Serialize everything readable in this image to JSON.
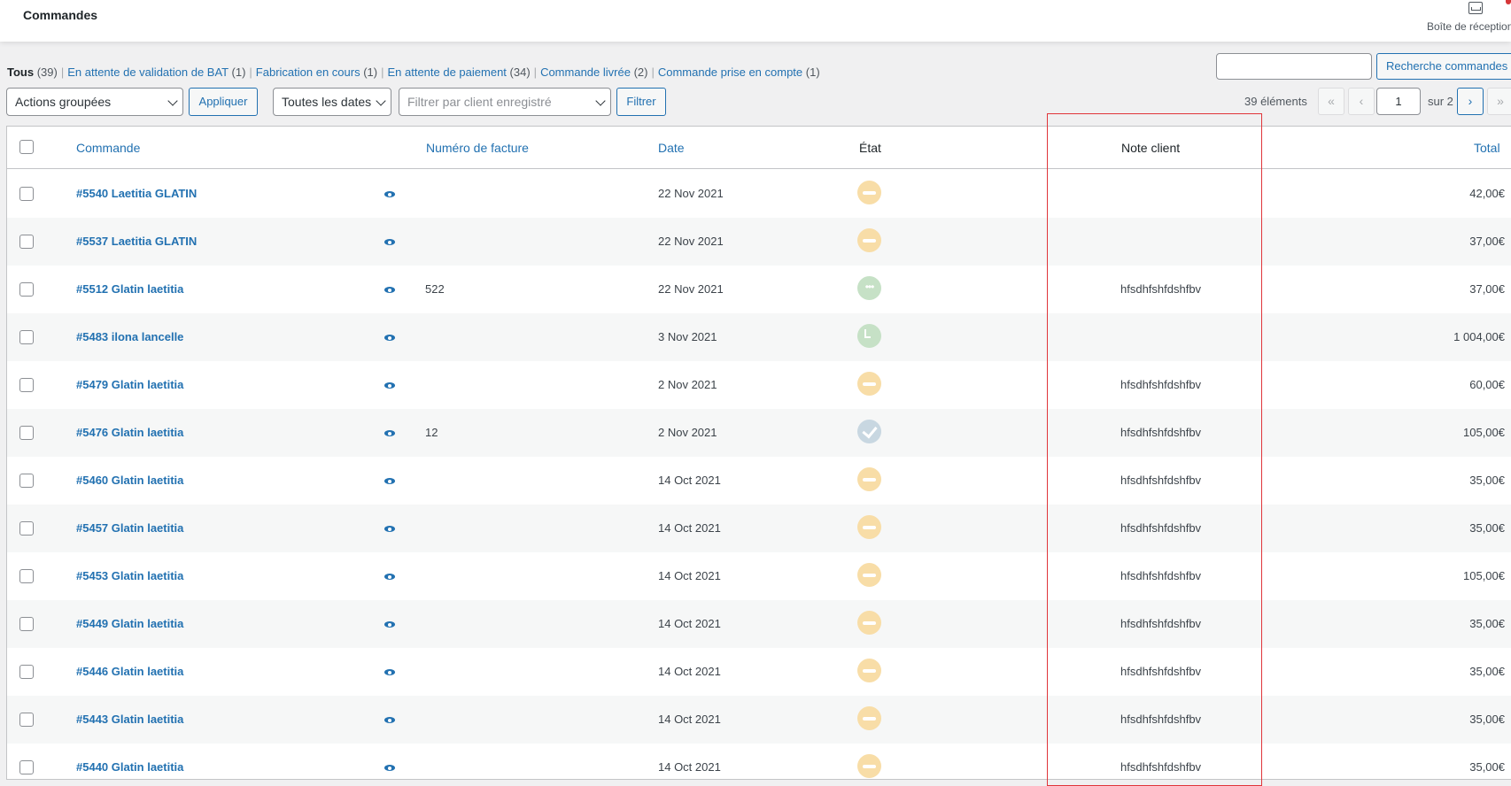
{
  "header": {
    "title": "Commandes",
    "inbox_label": "Boîte de réception"
  },
  "filters": {
    "all": {
      "label": "Tous",
      "count": "(39)"
    },
    "items": [
      {
        "label": "En attente de validation de BAT",
        "count": "(1)"
      },
      {
        "label": "Fabrication en cours",
        "count": "(1)"
      },
      {
        "label": "En attente de paiement",
        "count": "(34)"
      },
      {
        "label": "Commande livrée",
        "count": "(2)"
      },
      {
        "label": "Commande prise en compte",
        "count": "(1)"
      }
    ]
  },
  "search": {
    "value": "",
    "button": "Recherche commandes"
  },
  "toolbar": {
    "bulk_actions": "Actions groupées",
    "apply": "Appliquer",
    "dates": "Toutes les dates",
    "client_placeholder": "Filtrer par client enregistré",
    "filter": "Filtrer"
  },
  "pagination": {
    "count": "39 éléments",
    "first": "«",
    "prev": "‹",
    "next": "›",
    "last": "»",
    "current": "1",
    "of": "sur 2"
  },
  "columns": {
    "order": "Commande",
    "invoice": "Numéro de facture",
    "date": "Date",
    "status": "État",
    "note": "Note client",
    "total": "Total"
  },
  "rows": [
    {
      "order": "#5540 Laetitia GLATIN",
      "invoice": "",
      "date": "22 Nov 2021",
      "status": "pending",
      "note": "",
      "total": "42,00€"
    },
    {
      "order": "#5537 Laetitia GLATIN",
      "invoice": "",
      "date": "22 Nov 2021",
      "status": "pending",
      "note": "",
      "total": "37,00€"
    },
    {
      "order": "#5512 Glatin laetitia",
      "invoice": "522",
      "date": "22 Nov 2021",
      "status": "processing",
      "note": "hfsdhfshfdshfbv",
      "total": "37,00€"
    },
    {
      "order": "#5483 ilona lancelle",
      "invoice": "",
      "date": "3 Nov 2021",
      "status": "onhold",
      "note": "",
      "total": "1 004,00€"
    },
    {
      "order": "#5479 Glatin laetitia",
      "invoice": "",
      "date": "2 Nov 2021",
      "status": "pending",
      "note": "hfsdhfshfdshfbv",
      "total": "60,00€"
    },
    {
      "order": "#5476 Glatin laetitia",
      "invoice": "12",
      "date": "2 Nov 2021",
      "status": "completed",
      "note": "hfsdhfshfdshfbv",
      "total": "105,00€"
    },
    {
      "order": "#5460 Glatin laetitia",
      "invoice": "",
      "date": "14 Oct 2021",
      "status": "pending",
      "note": "hfsdhfshfdshfbv",
      "total": "35,00€"
    },
    {
      "order": "#5457 Glatin laetitia",
      "invoice": "",
      "date": "14 Oct 2021",
      "status": "pending",
      "note": "hfsdhfshfdshfbv",
      "total": "35,00€"
    },
    {
      "order": "#5453 Glatin laetitia",
      "invoice": "",
      "date": "14 Oct 2021",
      "status": "pending",
      "note": "hfsdhfshfdshfbv",
      "total": "105,00€"
    },
    {
      "order": "#5449 Glatin laetitia",
      "invoice": "",
      "date": "14 Oct 2021",
      "status": "pending",
      "note": "hfsdhfshfdshfbv",
      "total": "35,00€"
    },
    {
      "order": "#5446 Glatin laetitia",
      "invoice": "",
      "date": "14 Oct 2021",
      "status": "pending",
      "note": "hfsdhfshfdshfbv",
      "total": "35,00€"
    },
    {
      "order": "#5443 Glatin laetitia",
      "invoice": "",
      "date": "14 Oct 2021",
      "status": "pending",
      "note": "hfsdhfshfdshfbv",
      "total": "35,00€"
    },
    {
      "order": "#5440 Glatin laetitia",
      "invoice": "",
      "date": "14 Oct 2021",
      "status": "pending",
      "note": "hfsdhfshfdshfbv",
      "total": "35,00€"
    }
  ],
  "colors": {
    "link": "#2271b1",
    "highlight": "#e0353a",
    "pending": "#f8dda7",
    "processing": "#c6e1c6",
    "completed": "#c8d7e1"
  }
}
